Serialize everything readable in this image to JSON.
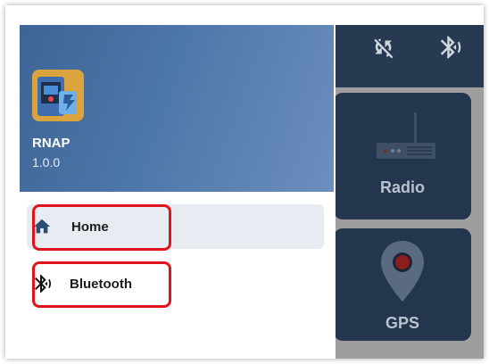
{
  "app": {
    "name": "RNAP",
    "version": "1.0.0"
  },
  "nav": {
    "items": [
      {
        "label": "Home",
        "icon": "home-icon",
        "active": true
      },
      {
        "label": "Bluetooth",
        "icon": "bluetooth-audio-icon",
        "active": false
      }
    ]
  },
  "tiles": {
    "radio_label": "Radio",
    "gps_label": "GPS"
  },
  "topbar": {
    "icons": [
      "sync-disabled-icon",
      "bluetooth-searching-icon"
    ]
  },
  "colors": {
    "header_gradient_start": "#3d6495",
    "header_gradient_end": "#6b8fbe",
    "active_item_bg": "#e7ecf3",
    "highlight_red": "#e0141b",
    "tile_bg": "#24364e",
    "topbar_bg": "#283a52"
  }
}
